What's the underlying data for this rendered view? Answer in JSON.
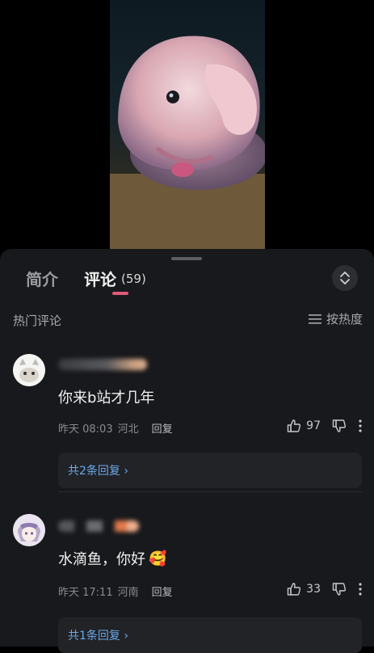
{
  "video": {
    "subject": "blobfish-video-frame"
  },
  "sheet": {
    "tabs": [
      {
        "label": "简介"
      },
      {
        "label": "评论",
        "count": "(59)"
      }
    ],
    "section_title": "热门评论",
    "sort_label": "按热度"
  },
  "comments": [
    {
      "text": "你来b站才几年",
      "time": "昨天 08:03",
      "location": "河北",
      "reply_label": "回复",
      "likes": "97",
      "replies_label": "共2条回复 ›"
    },
    {
      "text": "水滴鱼，你好",
      "emoji": "🥰",
      "time": "昨天 17:11",
      "location": "河南",
      "reply_label": "回复",
      "likes": "33",
      "replies_label": "共1条回复 ›"
    }
  ],
  "colors": {
    "sheet_bg": "#18191c",
    "accent_pink": "#e0587c",
    "link_blue": "#6aa8e8"
  }
}
